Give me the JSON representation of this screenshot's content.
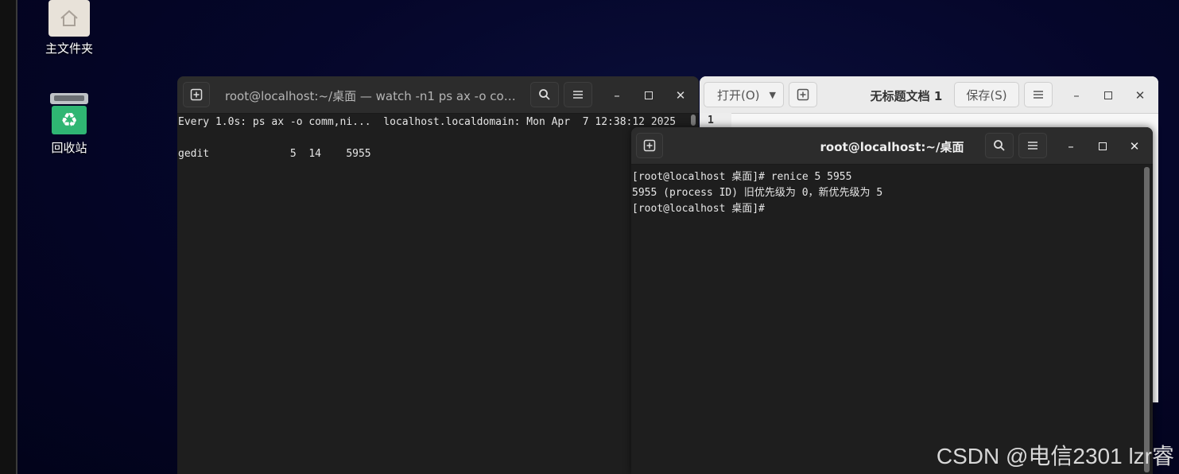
{
  "desktop": {
    "icons": [
      {
        "label": "主文件夹",
        "icon": "home-folder-icon"
      },
      {
        "label": "回收站",
        "icon": "recycle-bin-icon"
      }
    ]
  },
  "terminal_watch": {
    "title": "root@localhost:~/桌面 — watch -n1 ps ax -o comm,…",
    "lines": [
      "Every 1.0s: ps ax -o comm,ni...  localhost.localdomain: Mon Apr  7 12:38:12 2025",
      "",
      "gedit             5  14    5955"
    ]
  },
  "gedit": {
    "open_label": "打开(O)",
    "title": "无标题文档 1",
    "save_label": "保存(S)",
    "line_number": "1"
  },
  "terminal_shell": {
    "title": "root@localhost:~/桌面",
    "lines": [
      "[root@localhost 桌面]# renice 5 5955",
      "5955 (process ID) 旧优先级为 0，新优先级为 5",
      "[root@localhost 桌面]#"
    ]
  },
  "watermark": "CSDN @电信2301  lzr睿",
  "colors": {
    "terminal_bg": "#1e1e1e",
    "header_bg": "#2c2c2c",
    "recycle_green": "#2fb673"
  }
}
